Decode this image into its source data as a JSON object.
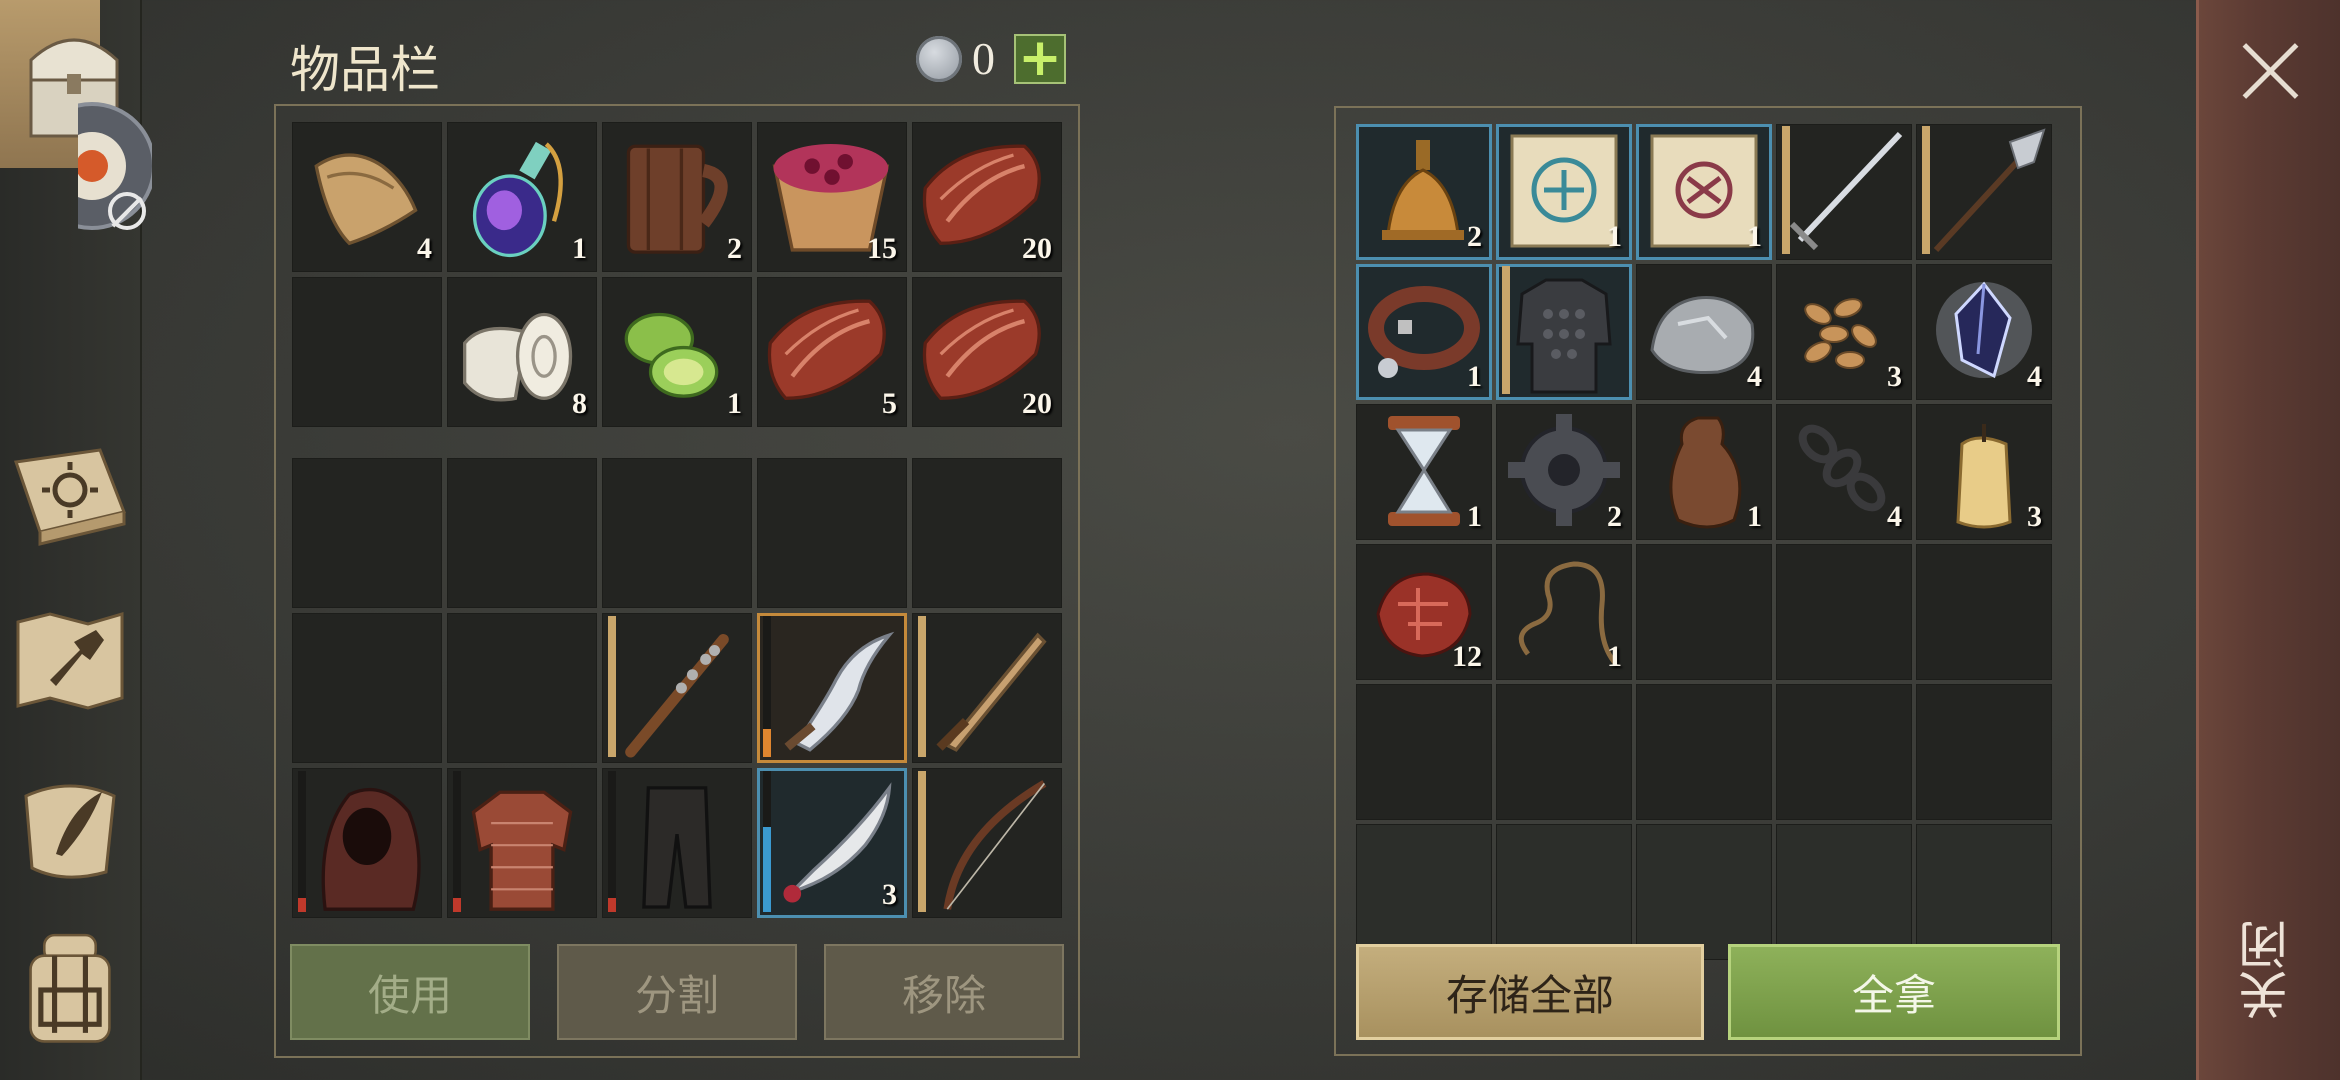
{
  "inventory": {
    "title": "物品栏",
    "currency": {
      "icon": "silver-coin-icon",
      "amount": "0"
    },
    "add_button": "+",
    "top_slots": [
      {
        "icon": "cloth-icon",
        "count": "4"
      },
      {
        "icon": "potion-icon",
        "count": "1"
      },
      {
        "icon": "mug-icon",
        "count": "2"
      },
      {
        "icon": "berry-bowl-icon",
        "count": "15"
      },
      {
        "icon": "raw-meat-icon",
        "count": "20"
      },
      {
        "icon": "",
        "count": ""
      },
      {
        "icon": "bandage-roll-icon",
        "count": "8"
      },
      {
        "icon": "cucumber-icon",
        "count": "1"
      },
      {
        "icon": "raw-meat-icon",
        "count": "5"
      },
      {
        "icon": "raw-meat-icon",
        "count": "20"
      }
    ],
    "bottom_slots": [
      {
        "icon": "",
        "count": ""
      },
      {
        "icon": "",
        "count": ""
      },
      {
        "icon": "",
        "count": ""
      },
      {
        "icon": "",
        "count": ""
      },
      {
        "icon": "",
        "count": ""
      },
      {
        "icon": "",
        "count": ""
      },
      {
        "icon": "",
        "count": ""
      },
      {
        "icon": "spiked-club-icon",
        "count": "",
        "durability": 1.0
      },
      {
        "icon": "curved-dagger-icon",
        "count": "",
        "durability": 0.2,
        "selected": true
      },
      {
        "icon": "bronze-sword-icon",
        "count": "",
        "durability": 1.0
      },
      {
        "icon": "hood-icon",
        "count": "",
        "durability": 0.1
      },
      {
        "icon": "gambeson-icon",
        "count": "",
        "durability": 0.1
      },
      {
        "icon": "pants-icon",
        "count": "",
        "durability": 0.1
      },
      {
        "icon": "scimitar-icon",
        "count": "3",
        "durability": 0.6,
        "equipped": true
      },
      {
        "icon": "bow-icon",
        "count": "",
        "durability": 1.0
      }
    ],
    "buttons": {
      "use": "使用",
      "split": "分割",
      "remove": "移除"
    }
  },
  "container": {
    "slots": [
      {
        "icon": "bell-icon",
        "count": "2",
        "highlight": true
      },
      {
        "icon": "blue-scroll-icon",
        "count": "1",
        "highlight": true
      },
      {
        "icon": "red-scroll-icon",
        "count": "1",
        "highlight": true
      },
      {
        "icon": "longsword-icon",
        "count": "",
        "durability": 1.0
      },
      {
        "icon": "halberd-icon",
        "count": "",
        "durability": 1.0
      },
      {
        "icon": "dog-collar-icon",
        "count": "1",
        "highlight": true
      },
      {
        "icon": "chainmail-icon",
        "count": "",
        "highlight": true,
        "durability": 1.0
      },
      {
        "icon": "stone-ore-icon",
        "count": "4"
      },
      {
        "icon": "seeds-icon",
        "count": "3"
      },
      {
        "icon": "crystal-icon",
        "count": "4"
      },
      {
        "icon": "hourglass-icon",
        "count": "1"
      },
      {
        "icon": "gear-icon",
        "count": "2"
      },
      {
        "icon": "leather-flask-icon",
        "count": "1"
      },
      {
        "icon": "chain-icon",
        "count": "4"
      },
      {
        "icon": "candle-icon",
        "count": "3"
      },
      {
        "icon": "flesh-chunk-icon",
        "count": "12"
      },
      {
        "icon": "rope-icon",
        "count": "1"
      },
      {
        "icon": "",
        "count": ""
      },
      {
        "icon": "",
        "count": ""
      },
      {
        "icon": "",
        "count": ""
      },
      {
        "icon": "",
        "count": ""
      },
      {
        "icon": "",
        "count": ""
      },
      {
        "icon": "",
        "count": ""
      },
      {
        "icon": "",
        "count": ""
      },
      {
        "icon": "",
        "count": ""
      },
      {
        "icon": "",
        "count": ""
      },
      {
        "icon": "",
        "count": ""
      },
      {
        "icon": "",
        "count": ""
      },
      {
        "icon": "",
        "count": ""
      },
      {
        "icon": "",
        "count": ""
      }
    ],
    "buttons": {
      "store_all": "存储全部",
      "take_all": "全拿"
    }
  },
  "close": {
    "label": "关闭"
  },
  "sidebar": {
    "items": [
      {
        "icon": "chest-icon"
      },
      {
        "icon": "sun-book-icon"
      },
      {
        "icon": "hammer-map-icon"
      },
      {
        "icon": "quill-scroll-icon"
      },
      {
        "icon": "backpack-icon"
      }
    ]
  },
  "colors": {
    "selection_blue": "#4c8fb0",
    "accent_green": "#6f8f45",
    "durability_red": "#c0392b",
    "durability_tan": "#c9a66b",
    "durability_blue": "#3b9ad0",
    "durability_orange": "#e0862f"
  }
}
